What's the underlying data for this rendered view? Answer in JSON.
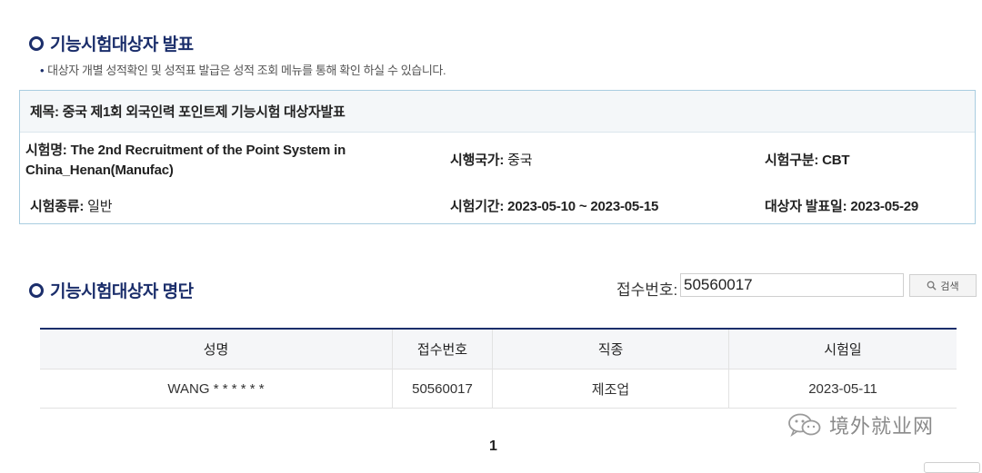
{
  "section1": {
    "title": "기능시험대상자 발표",
    "note": "대상자 개별 성적확인 및 성적표 발급은 성적 조회 메뉴를 통해 확인 하실 수 있습니다."
  },
  "info": {
    "subject_label": "제목:",
    "subject_value": "중국 제1회 외국인력 포인트제 기능시험 대상자발표",
    "exam_name_label": "시험명:",
    "exam_name_value": "The 2nd Recruitment of the Point System in China_Henan(Manufac)",
    "country_label": "시행국가:",
    "country_value": "중국",
    "exam_type_label": "시험구분:",
    "exam_type_value": "CBT",
    "exam_kind_label": "시험종류:",
    "exam_kind_value": "일반",
    "period_label": "시험기간:",
    "period_value": "2023-05-10 ~ 2023-05-15",
    "announce_label": "대상자 발표일:",
    "announce_value": "2023-05-29"
  },
  "section2": {
    "title": "기능시험대상자 명단"
  },
  "search": {
    "label": "접수번호:",
    "value": "50560017",
    "button_label": "검색"
  },
  "table": {
    "headers": [
      "성명",
      "접수번호",
      "직종",
      "시험일"
    ],
    "rows": [
      [
        "WANG * * * * * *",
        "50560017",
        "제조업",
        "2023-05-11"
      ]
    ]
  },
  "pagination": {
    "current": "1"
  },
  "watermark": {
    "text": "境外就业网"
  },
  "colors": {
    "accent": "#1b2e6b",
    "box_border": "#a9cde0",
    "header_bg": "#f4f7f9"
  }
}
